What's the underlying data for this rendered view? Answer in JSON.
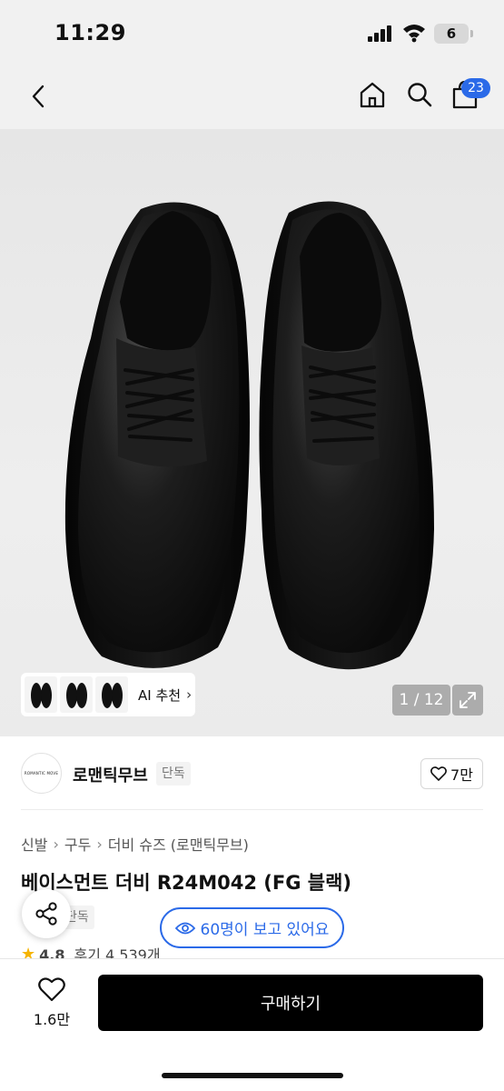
{
  "status_bar": {
    "time": "11:29",
    "battery": "6"
  },
  "nav": {
    "cart_count": "23"
  },
  "hero": {
    "ai_recommend_label": "AI 추천",
    "page_counter": "1 / 12",
    "thumbnail_count": 3
  },
  "seller": {
    "logo_text": "ROMANTIC MOVE",
    "name": "로맨틱무브",
    "tag": "단독",
    "likes": "7만"
  },
  "breadcrumb": [
    "신발",
    "구두",
    "더비 슈즈 (로맨틱무브)"
  ],
  "product": {
    "title": "베이스먼트 더비 R24M042 (FG 블랙)",
    "partial_tag": "단독",
    "viewers": "60명이 보고 있어요",
    "rating": "4.8",
    "reviews": "후기 4,539개"
  },
  "bottom_bar": {
    "wish_count": "1.6만",
    "buy_label": "구매하기"
  },
  "colors": {
    "accent_blue": "#2b6ae8",
    "buy_button": "#000000",
    "header_bg": "#f1f1f1",
    "star": "#f5b301"
  }
}
